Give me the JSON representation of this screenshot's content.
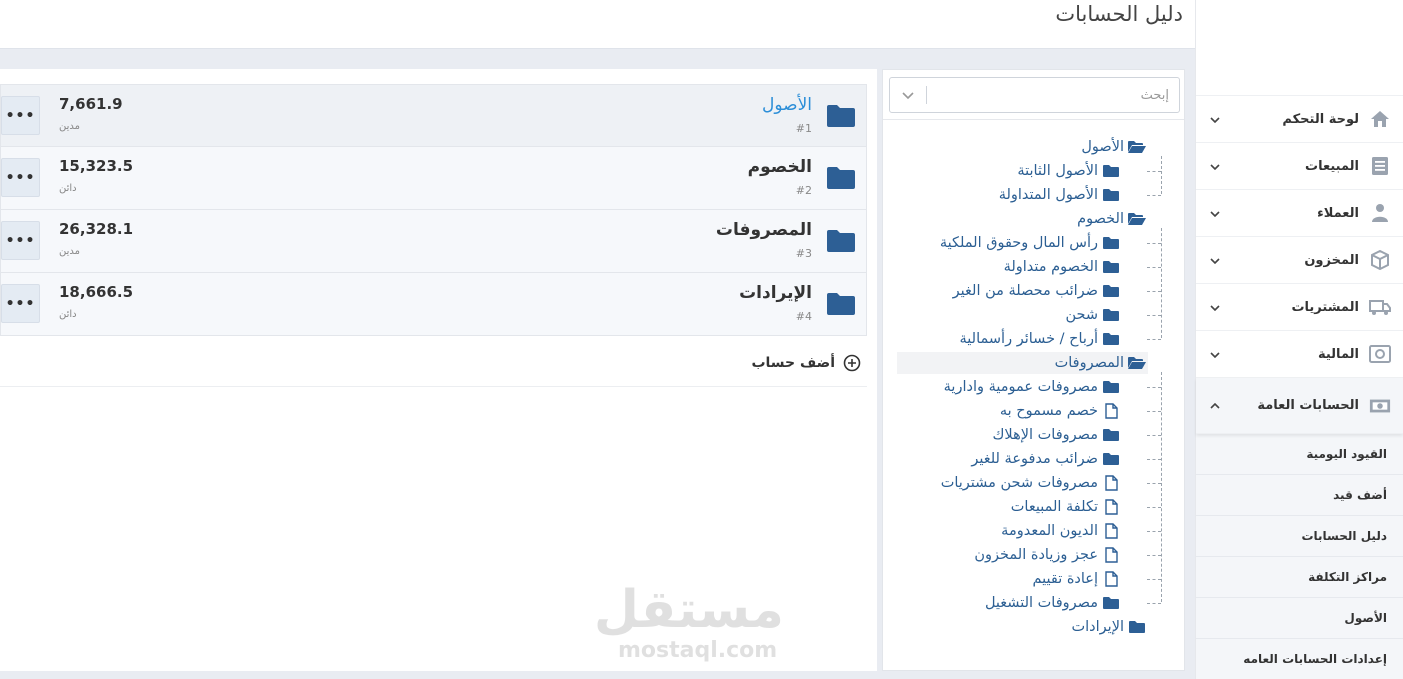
{
  "header": {
    "title": "دليل الحسابات"
  },
  "sidebar": {
    "items": [
      {
        "label": "لوحة التحكم",
        "icon": "home-icon"
      },
      {
        "label": "المبيعات",
        "icon": "invoice-icon"
      },
      {
        "label": "العملاء",
        "icon": "user-icon"
      },
      {
        "label": "المخزون",
        "icon": "box-icon"
      },
      {
        "label": "المشتريات",
        "icon": "truck-icon"
      },
      {
        "label": "المالية",
        "icon": "safe-icon"
      },
      {
        "label": "الحسابات العامة",
        "icon": "money-icon"
      }
    ],
    "subitems": [
      {
        "label": "القيود اليومية"
      },
      {
        "label": "أضف قيد"
      },
      {
        "label": "دليل الحسابات"
      },
      {
        "label": "مراكز التكلفة"
      },
      {
        "label": "الأصول"
      },
      {
        "label": "إعدادات الحسابات العامه"
      }
    ]
  },
  "search": {
    "placeholder": "إبحث"
  },
  "tree": {
    "nodes": [
      {
        "label": "الأصول",
        "type": "folder-open"
      },
      {
        "label": "الأصول الثابتة",
        "type": "folder"
      },
      {
        "label": "الأصول المتداولة",
        "type": "folder"
      },
      {
        "label": "الخصوم",
        "type": "folder-open"
      },
      {
        "label": "رأس المال وحقوق الملكية",
        "type": "folder"
      },
      {
        "label": "الخصوم متداولة",
        "type": "folder"
      },
      {
        "label": "ضرائب محصلة من الغير",
        "type": "folder"
      },
      {
        "label": "شحن",
        "type": "folder"
      },
      {
        "label": "أرباح / خسائر رأسمالية",
        "type": "folder"
      },
      {
        "label": "المصروفات",
        "type": "folder-open"
      },
      {
        "label": "مصروفات عمومية وادارية",
        "type": "folder"
      },
      {
        "label": "خصم مسموح به",
        "type": "file"
      },
      {
        "label": "مصروفات الإهلاك",
        "type": "folder"
      },
      {
        "label": "ضرائب مدفوعة للغير",
        "type": "folder"
      },
      {
        "label": "مصروفات شحن مشتريات",
        "type": "file"
      },
      {
        "label": "تكلفة المبيعات",
        "type": "file"
      },
      {
        "label": "الديون المعدومة",
        "type": "file"
      },
      {
        "label": "عجز وزيادة المخزون",
        "type": "file"
      },
      {
        "label": "إعادة تقييم",
        "type": "file"
      },
      {
        "label": "مصروفات التشغيل",
        "type": "folder"
      },
      {
        "label": "الإيرادات",
        "type": "folder"
      }
    ]
  },
  "accounts": [
    {
      "name": "الأصول",
      "code": "#1",
      "amount": "7,661.9",
      "type": "مدين",
      "more": "•••"
    },
    {
      "name": "الخصوم",
      "code": "#2",
      "amount": "15,323.5",
      "type": "دائن",
      "more": "•••"
    },
    {
      "name": "المصروفات",
      "code": "#3",
      "amount": "26,328.1",
      "type": "مدين",
      "more": "•••"
    },
    {
      "name": "الإيرادات",
      "code": "#4",
      "amount": "18,666.5",
      "type": "دائن",
      "more": "•••"
    }
  ],
  "add_account": {
    "label": "أضف حساب"
  },
  "watermark": {
    "arabic": "مستقل",
    "latin": "mostaql.com"
  },
  "colors": {
    "folder": "#2d5f95",
    "link": "#2b8ed8",
    "tree_text": "#2c5f93"
  }
}
